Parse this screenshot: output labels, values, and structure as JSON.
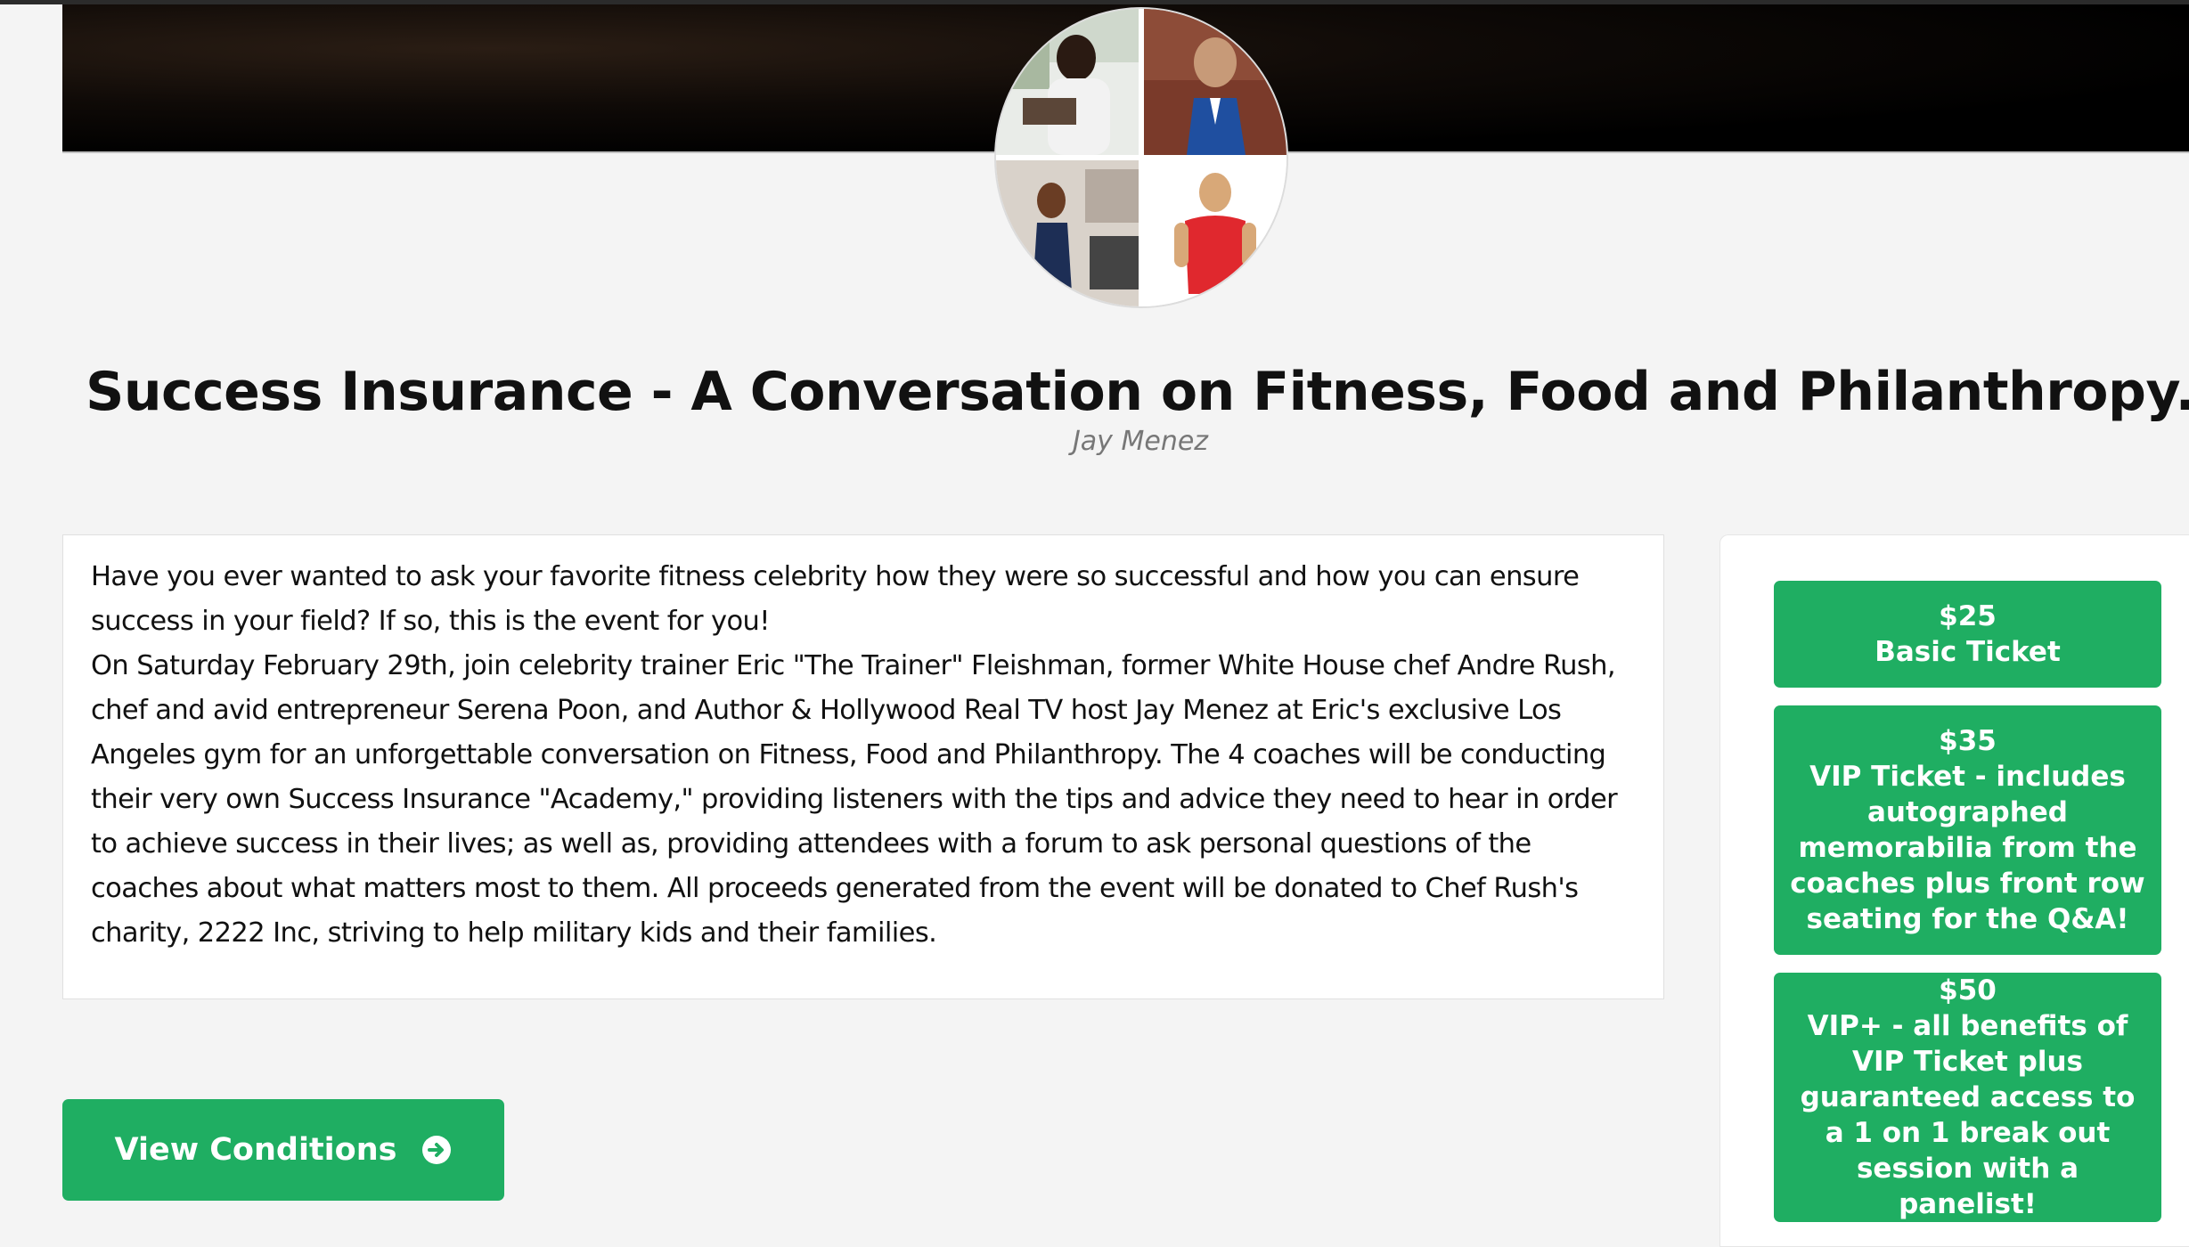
{
  "event": {
    "title": "Success Insurance - A Conversation on Fitness, Food and Philanthropy.",
    "organizer": "Jay Menez",
    "description": [
      "Have you ever wanted to ask your favorite fitness celebrity how they were so successful and how you can ensure success in your field? If so, this is the event for you!",
      "On Saturday February 29th, join celebrity trainer Eric \"The Trainer\" Fleishman, former White House chef Andre Rush, chef and avid entrepreneur Serena Poon, and Author & Hollywood Real TV host Jay Menez at Eric's exclusive Los Angeles gym for an unforgettable conversation on Fitness, Food and Philanthropy. The 4 coaches will be conducting their very own Success Insurance \"Academy,\" providing listeners with the tips and advice they need to hear in order to achieve success in their lives; as well as, providing attendees with a forum to ask personal questions of the coaches about what matters most to them. All proceeds generated from the event will be donated to Chef Rush's charity, 2222 Inc, striving to help military kids and their families."
    ]
  },
  "actions": {
    "view_conditions_label": "View Conditions",
    "view_conditions_icon": "arrow-circle-right-icon"
  },
  "tickets": [
    {
      "price": "$25",
      "label": "Basic Ticket"
    },
    {
      "price": "$35",
      "label": "VIP Ticket - includes autographed memorabilia from the coaches plus front row seating for the Q&A!"
    },
    {
      "price": "$50",
      "label": "VIP+ - all benefits of VIP Ticket plus guaranteed access to a 1 on 1 break out session with a panelist!"
    }
  ],
  "colors": {
    "accent": "#1fae62",
    "page_background": "#f4f4f4",
    "hero_background": "#000000"
  }
}
